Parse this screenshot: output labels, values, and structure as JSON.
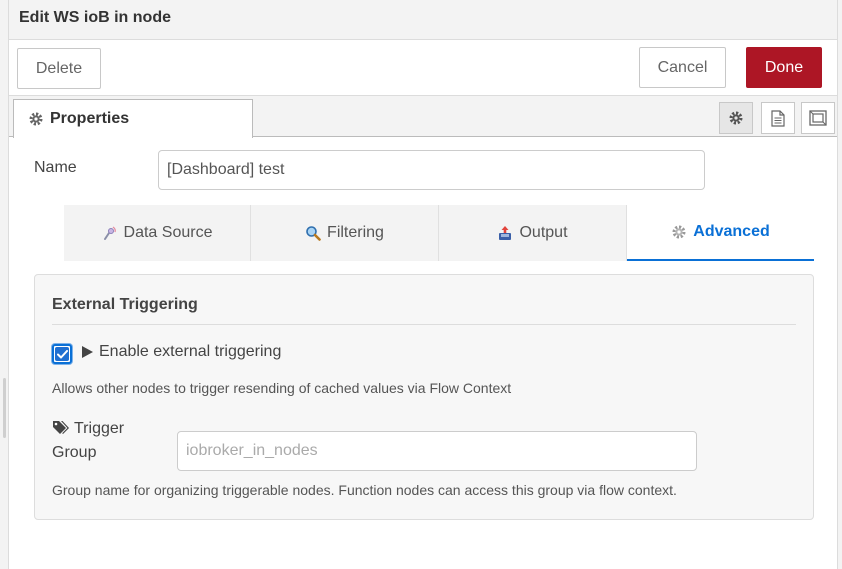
{
  "tray": {
    "title": "Edit WS ioB in node"
  },
  "toolbar": {
    "delete_label": "Delete",
    "cancel_label": "Cancel",
    "done_label": "Done"
  },
  "tabs": {
    "properties_label": "Properties"
  },
  "header_icons": [
    "gear-icon",
    "file-text-icon",
    "layout-icon"
  ],
  "form": {
    "name_label": "Name",
    "name_value": "[Dashboard] test"
  },
  "subtabs": [
    {
      "label": "Data Source",
      "icon": "antenna-icon"
    },
    {
      "label": "Filtering",
      "icon": "magnifier-icon"
    },
    {
      "label": "Output",
      "icon": "inbox-out-icon"
    },
    {
      "label": "Advanced",
      "icon": "gear-icon",
      "active": true
    }
  ],
  "advanced": {
    "section_title": "External Triggering",
    "enable_label": "Enable external triggering",
    "enable_checked": true,
    "enable_help": "Allows other nodes to trigger resending of cached values via Flow Context",
    "trigger_group_label_1": "Trigger",
    "trigger_group_label_2": "Group",
    "trigger_group_placeholder": "iobroker_in_nodes",
    "trigger_group_value": "",
    "trigger_group_help": "Group name for organizing triggerable nodes. Function nodes can access this group via flow context."
  },
  "colors": {
    "accent": "#0a70d6",
    "done": "#ad1625",
    "panel_bg": "#f7f7f7"
  }
}
